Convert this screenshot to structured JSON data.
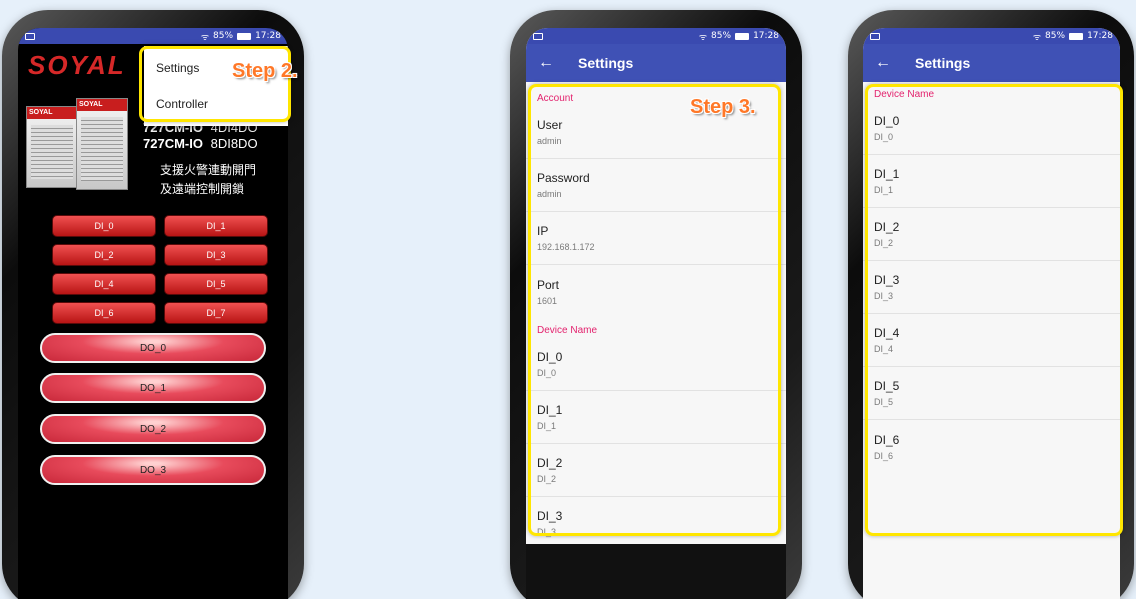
{
  "status": {
    "signal": "85%",
    "time": "17:28"
  },
  "phone1": {
    "logo": "SOYAL",
    "menu": {
      "settings": "Settings",
      "controller": "Controller"
    },
    "step": "Step 2.",
    "device_labels": [
      "SOYAL",
      "SOYAL"
    ],
    "models": [
      {
        "name": "727CM-IO",
        "io": "4DI4DO"
      },
      {
        "name": "727CM-IO",
        "io": "8DI8DO"
      }
    ],
    "desc": [
      "支援火警連動開門",
      "及遠端控制開鎖"
    ],
    "di_buttons": [
      "DI_0",
      "DI_1",
      "DI_2",
      "DI_3",
      "DI_4",
      "DI_5",
      "DI_6",
      "DI_7"
    ],
    "do_buttons": [
      "DO_0",
      "DO_1",
      "DO_2",
      "DO_3"
    ]
  },
  "phone2": {
    "title": "Settings",
    "step": "Step 3.",
    "account_header": "Account",
    "account": [
      {
        "title": "User",
        "summary": "admin"
      },
      {
        "title": "Password",
        "summary": "admin"
      },
      {
        "title": "IP",
        "summary": "192.168.1.172"
      },
      {
        "title": "Port",
        "summary": "1601"
      }
    ],
    "device_header": "Device Name",
    "devices": [
      {
        "title": "DI_0",
        "summary": "DI_0"
      },
      {
        "title": "DI_1",
        "summary": "DI_1"
      },
      {
        "title": "DI_2",
        "summary": "DI_2"
      },
      {
        "title": "DI_3",
        "summary": "DI_3"
      }
    ]
  },
  "phone3": {
    "title": "Settings",
    "device_header": "Device Name",
    "devices": [
      {
        "title": "DI_0",
        "summary": "DI_0"
      },
      {
        "title": "DI_1",
        "summary": "DI_1"
      },
      {
        "title": "DI_2",
        "summary": "DI_2"
      },
      {
        "title": "DI_3",
        "summary": "DI_3"
      },
      {
        "title": "DI_4",
        "summary": "DI_4"
      },
      {
        "title": "DI_5",
        "summary": "DI_5"
      },
      {
        "title": "DI_6",
        "summary": "DI_6"
      }
    ]
  },
  "colors": {
    "appbar": "#3f51b5",
    "statusbar": "#3a4ab0",
    "accent": "#e3236e",
    "highlight": "#ffe600",
    "step_text": "#ff7828",
    "di_button": "#d42a2a",
    "do_button": "#e84b5c"
  }
}
